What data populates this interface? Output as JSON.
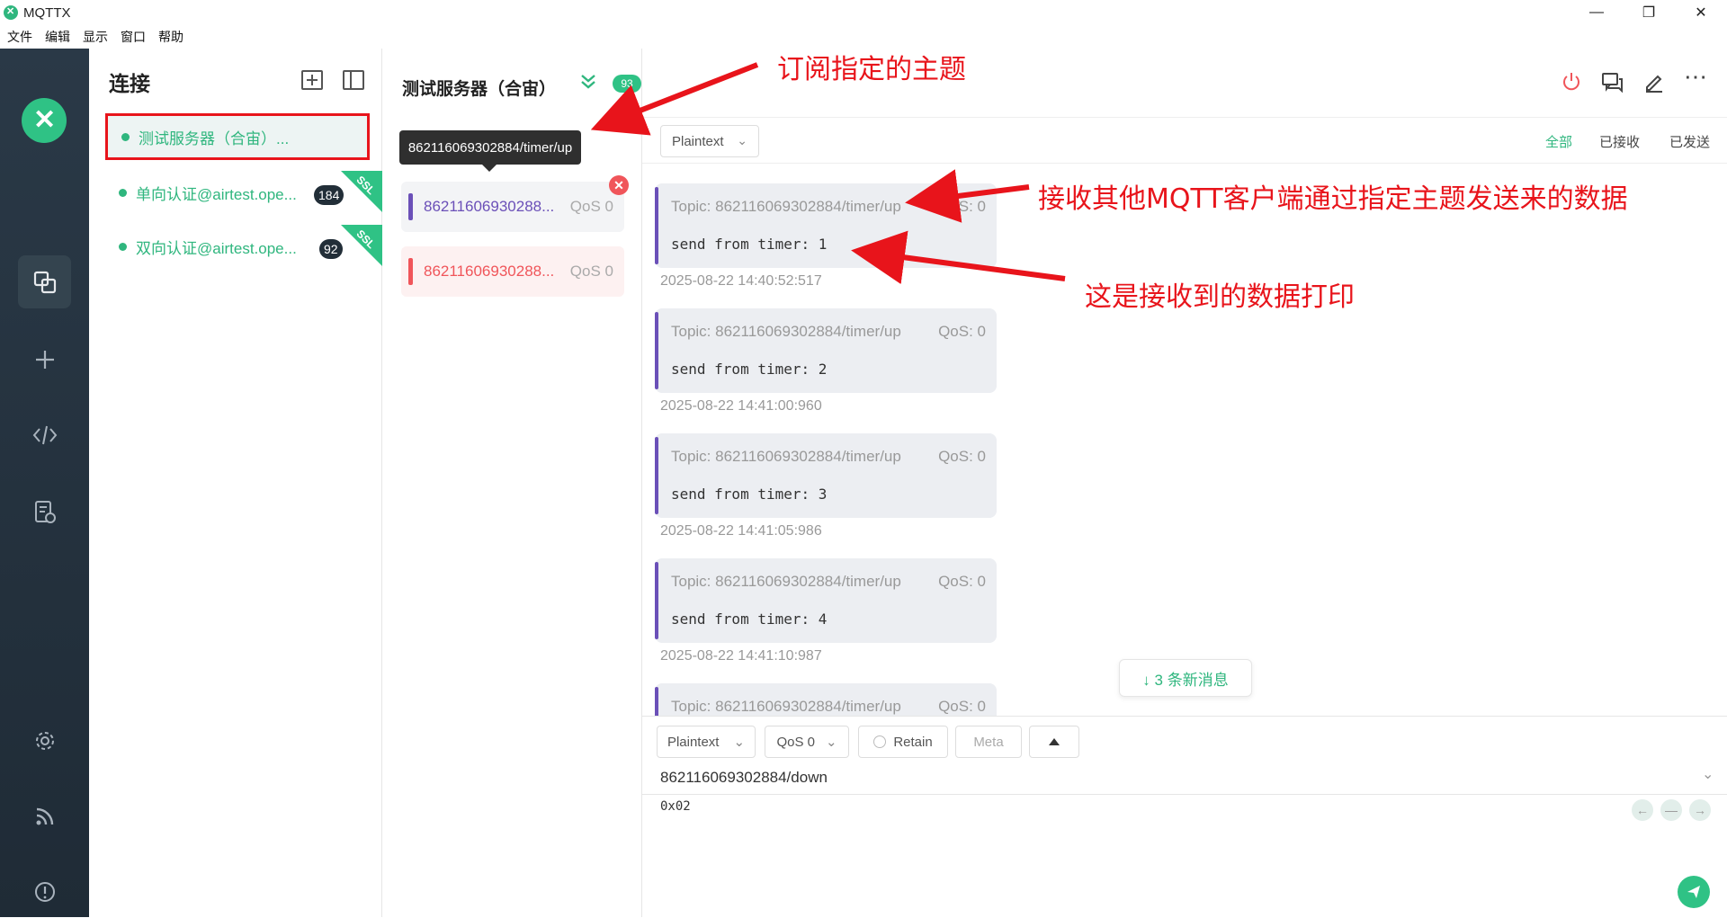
{
  "window": {
    "title": "MQTTX",
    "controls": [
      "—",
      "❐",
      "✕"
    ]
  },
  "menubar": [
    "文件",
    "编辑",
    "显示",
    "窗口",
    "帮助"
  ],
  "leftbar": {
    "icons": [
      "connections-icon",
      "new-connection-icon",
      "script-icon",
      "log-icon",
      "settings-icon",
      "feed-icon",
      "about-icon"
    ]
  },
  "connections": {
    "title": "连接",
    "items": [
      {
        "name": "测试服务器（合宙）...",
        "badge": "",
        "ssl": false
      },
      {
        "name": "单向认证@airtest.ope...",
        "badge": "184",
        "ssl": true,
        "ssl_label": "SSL"
      },
      {
        "name": "双向认证@airtest.ope...",
        "badge": "92",
        "ssl": true,
        "ssl_label": "SSL"
      }
    ]
  },
  "subscriptions": {
    "server_name": "测试服务器（合宙）",
    "message_count": "93",
    "tooltip": "862116069302884/timer/up",
    "items": [
      {
        "topic": "86211606930288...",
        "qos": "QoS 0",
        "color": "#6b50b8",
        "bg": "#f3f4f6"
      },
      {
        "topic": "86211606930288...",
        "qos": "QoS 0",
        "color": "#f0555a",
        "bg": "#fdf1f1"
      }
    ]
  },
  "filter": {
    "format": "Plaintext",
    "tabs": [
      "全部",
      "已接收",
      "已发送"
    ]
  },
  "messages": [
    {
      "topic": "Topic: 862116069302884/timer/up",
      "qos": "QoS: 0",
      "payload": "send from timer: 1",
      "time": "2025-08-22 14:40:52:517"
    },
    {
      "topic": "Topic: 862116069302884/timer/up",
      "qos": "QoS: 0",
      "payload": "send from timer: 2",
      "time": "2025-08-22 14:41:00:960"
    },
    {
      "topic": "Topic: 862116069302884/timer/up",
      "qos": "QoS: 0",
      "payload": "send from timer: 3",
      "time": "2025-08-22 14:41:05:986"
    },
    {
      "topic": "Topic: 862116069302884/timer/up",
      "qos": "QoS: 0",
      "payload": "send from timer: 4",
      "time": "2025-08-22 14:41:10:987"
    },
    {
      "topic": "Topic: 862116069302884/timer/up",
      "qos": "QoS: 0",
      "payload": "",
      "time": ""
    }
  ],
  "new_messages": "↓ 3 条新消息",
  "composer": {
    "format": "Plaintext",
    "qos": "QoS 0",
    "retain": "Retain",
    "meta": "Meta",
    "topic": "862116069302884/down",
    "payload": "0x02"
  },
  "annotations": {
    "subscribe": "订阅指定的主题",
    "receive": "接收其他MQTT客户端通过指定主题发送来的数据",
    "print": "这是接收到的数据打印"
  },
  "colors": {
    "accent": "#2fb67e",
    "annotation": "#e8141b",
    "sidebar": "#26343f"
  }
}
